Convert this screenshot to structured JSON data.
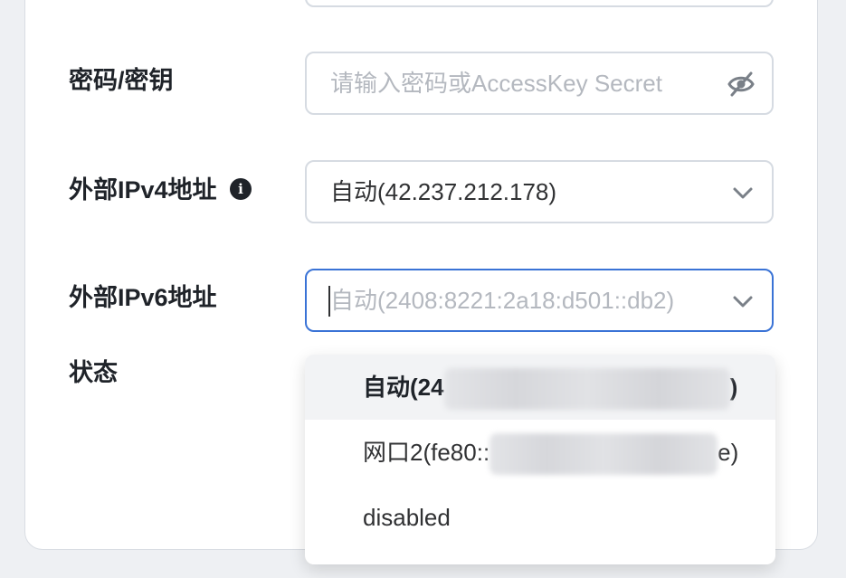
{
  "form": {
    "password": {
      "label": "密码/密钥",
      "placeholder": "请输入密码或AccessKey Secret",
      "toggle_icon": "eye-off-icon"
    },
    "ipv4": {
      "label": "外部IPv4地址",
      "info_icon": "info-icon",
      "value": "自动(42.237.212.178)"
    },
    "ipv6": {
      "label": "外部IPv6地址",
      "placeholder": "自动(2408:8221:2a18:d501::db2)"
    },
    "status": {
      "label": "状态"
    }
  },
  "dropdown": {
    "options": [
      {
        "prefix": "自动(24",
        "suffix": ")",
        "state": "hover"
      },
      {
        "prefix": "网口2(fe80::",
        "suffix": "e)"
      },
      {
        "prefix": "disabled",
        "suffix": ""
      }
    ]
  },
  "colors": {
    "focus_border": "#3a73d6",
    "border": "#d6dbe2",
    "text": "#303133",
    "placeholder": "#b4b8bf"
  }
}
